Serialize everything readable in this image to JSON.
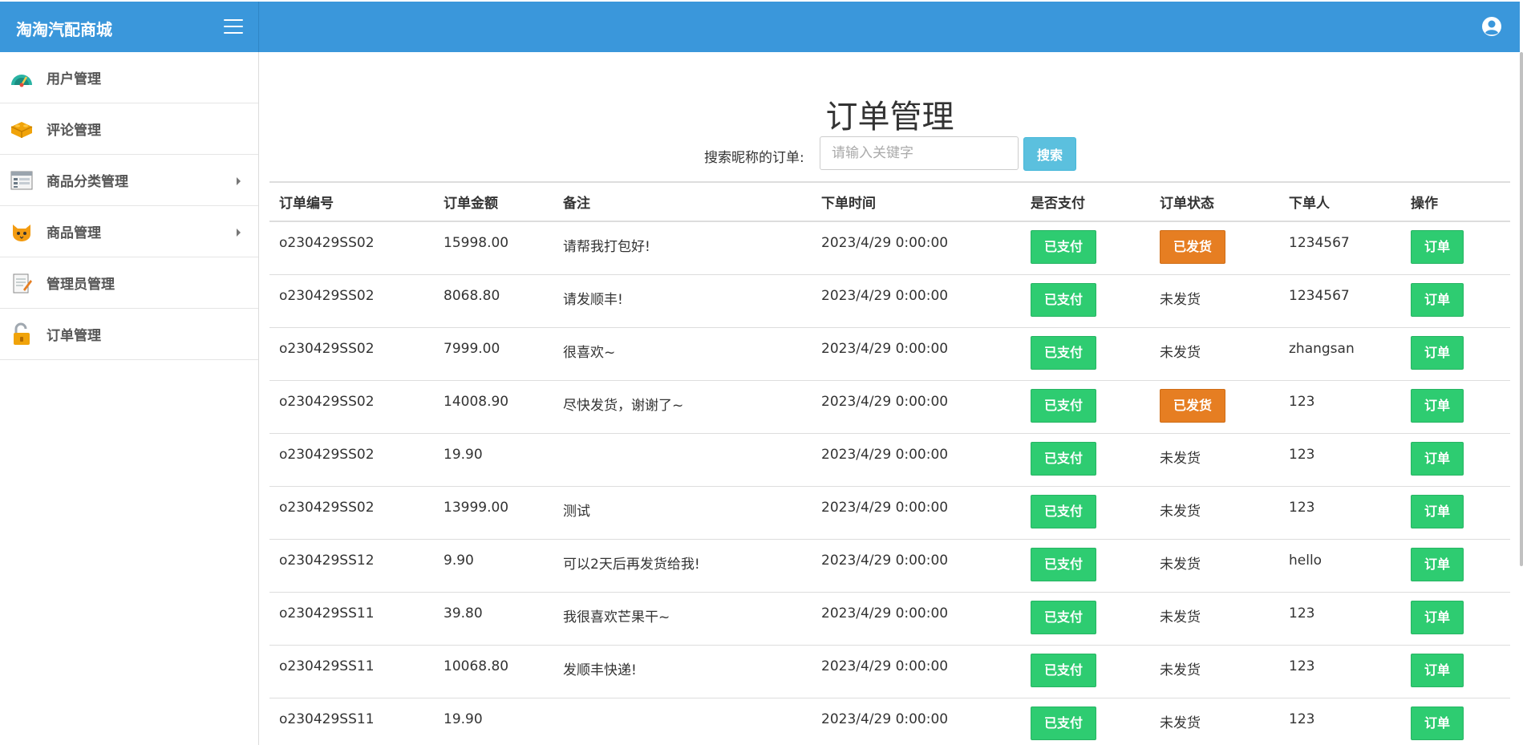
{
  "app": {
    "title": "淘淘汽配商城"
  },
  "icons": {
    "menu": "hamburger-icon",
    "user": "user-circle-icon"
  },
  "colors": {
    "primary": "#3a97db",
    "success": "#2ecc71",
    "warning": "#e67e22",
    "info": "#5bc0de"
  },
  "sidebar": {
    "items": [
      {
        "label": "用户管理",
        "icon": "dashboard-gauge-icon",
        "has_submenu": false
      },
      {
        "label": "评论管理",
        "icon": "lego-brick-icon",
        "has_submenu": false
      },
      {
        "label": "商品分类管理",
        "icon": "browser-window-icon",
        "has_submenu": true
      },
      {
        "label": "商品管理",
        "icon": "cat-face-icon",
        "has_submenu": true
      },
      {
        "label": "管理员管理",
        "icon": "notepad-pencil-icon",
        "has_submenu": false
      },
      {
        "label": "订单管理",
        "icon": "unlocked-padlock-icon",
        "has_submenu": false
      }
    ]
  },
  "main": {
    "title": "订单管理",
    "search": {
      "label": "搜索昵称的订单:",
      "placeholder": "请输入关键字",
      "value": "",
      "button": "搜索"
    },
    "table": {
      "headers": [
        "订单编号",
        "订单金额",
        "备注",
        "下单时间",
        "是否支付",
        "订单状态",
        "下单人",
        "操作"
      ],
      "rows": [
        {
          "id": "o230429SS02",
          "amount": "15998.00",
          "note": "请帮我打包好!",
          "time": "2023/4/29 0:00:00",
          "paid": "已支付",
          "status": "已发货",
          "shipped": true,
          "user": "1234567",
          "action": "订单"
        },
        {
          "id": "o230429SS02",
          "amount": "8068.80",
          "note": "请发顺丰!",
          "time": "2023/4/29 0:00:00",
          "paid": "已支付",
          "status": "未发货",
          "shipped": false,
          "user": "1234567",
          "action": "订单"
        },
        {
          "id": "o230429SS02",
          "amount": "7999.00",
          "note": "很喜欢~",
          "time": "2023/4/29 0:00:00",
          "paid": "已支付",
          "status": "未发货",
          "shipped": false,
          "user": "zhangsan",
          "action": "订单"
        },
        {
          "id": "o230429SS02",
          "amount": "14008.90",
          "note": "尽快发货，谢谢了~",
          "time": "2023/4/29 0:00:00",
          "paid": "已支付",
          "status": "已发货",
          "shipped": true,
          "user": "123",
          "action": "订单"
        },
        {
          "id": "o230429SS02",
          "amount": "19.90",
          "note": "",
          "time": "2023/4/29 0:00:00",
          "paid": "已支付",
          "status": "未发货",
          "shipped": false,
          "user": "123",
          "action": "订单"
        },
        {
          "id": "o230429SS02",
          "amount": "13999.00",
          "note": "测试",
          "time": "2023/4/29 0:00:00",
          "paid": "已支付",
          "status": "未发货",
          "shipped": false,
          "user": "123",
          "action": "订单"
        },
        {
          "id": "o230429SS12",
          "amount": "9.90",
          "note": "可以2天后再发货给我!",
          "time": "2023/4/29 0:00:00",
          "paid": "已支付",
          "status": "未发货",
          "shipped": false,
          "user": "hello",
          "action": "订单"
        },
        {
          "id": "o230429SS11",
          "amount": "39.80",
          "note": "我很喜欢芒果干~",
          "time": "2023/4/29 0:00:00",
          "paid": "已支付",
          "status": "未发货",
          "shipped": false,
          "user": "123",
          "action": "订单"
        },
        {
          "id": "o230429SS11",
          "amount": "10068.80",
          "note": "发顺丰快递!",
          "time": "2023/4/29 0:00:00",
          "paid": "已支付",
          "status": "未发货",
          "shipped": false,
          "user": "123",
          "action": "订单"
        },
        {
          "id": "o230429SS11",
          "amount": "19.90",
          "note": "",
          "time": "2023/4/29 0:00:00",
          "paid": "已支付",
          "status": "未发货",
          "shipped": false,
          "user": "123",
          "action": "订单"
        }
      ]
    }
  }
}
